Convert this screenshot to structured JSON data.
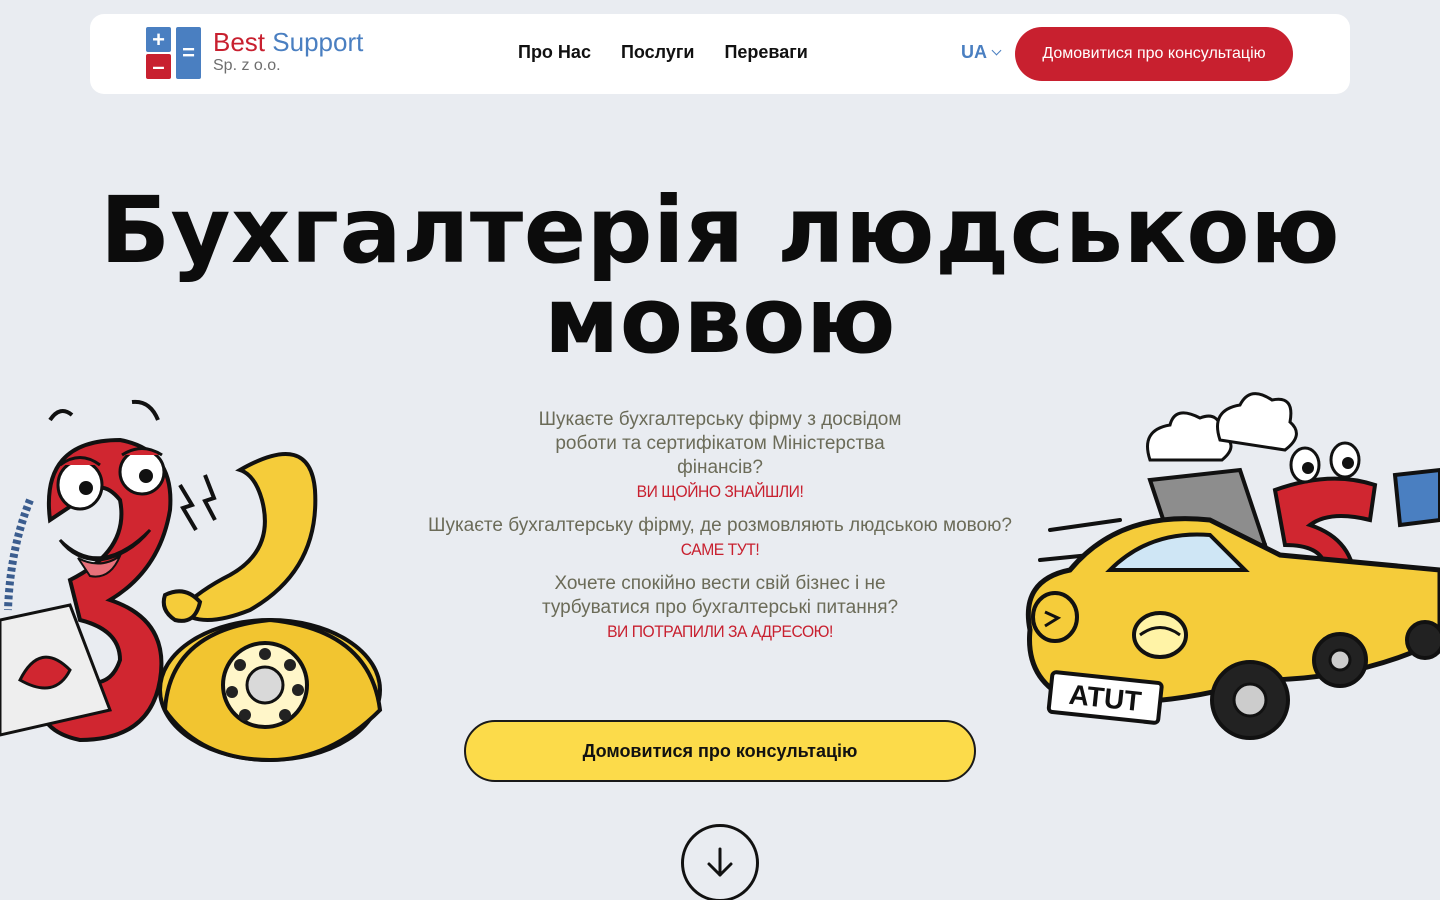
{
  "header": {
    "logo": {
      "brand_first": "Best",
      "brand_second": "Support",
      "subtitle": "Sp. z o.o."
    },
    "nav": [
      {
        "label": "Про Нас"
      },
      {
        "label": "Послуги"
      },
      {
        "label": "Переваги"
      }
    ],
    "language": "UA",
    "cta_label": "Домовитися про консультацію"
  },
  "hero": {
    "title_line1": "Бухгалтерія людською",
    "title_line2": "мовою",
    "blocks": [
      {
        "question": "Шукаєте бухгалтерську фірму з досвідом роботи та сертифікатом Міністерства фінансів?",
        "answer": "ВИ ЩОЙНО ЗНАЙШЛИ!"
      },
      {
        "question": "Шукаєте бухгалтерську фірму, де розмовляють людською мовою?",
        "answer": "САМЕ ТУТ!"
      },
      {
        "question": "Хочете спокійно вести свій бізнес і не турбуватися про бухгалтерські питання?",
        "answer": "ВИ ПОТРАПИЛИ ЗА АДРЕСОЮ!"
      }
    ],
    "cta_label": "Домовитися про консультацію",
    "car_plate": "ATUT"
  },
  "colors": {
    "brand_red": "#c8202f",
    "brand_blue": "#4a7fc1",
    "accent_yellow": "#fcdb4a",
    "background": "#e9ecf1"
  },
  "icons": {
    "logo": "calculator-plus-minus-equals-icon",
    "language_chevron": "chevron-down-icon",
    "scroll": "arrow-down-circle-icon"
  }
}
